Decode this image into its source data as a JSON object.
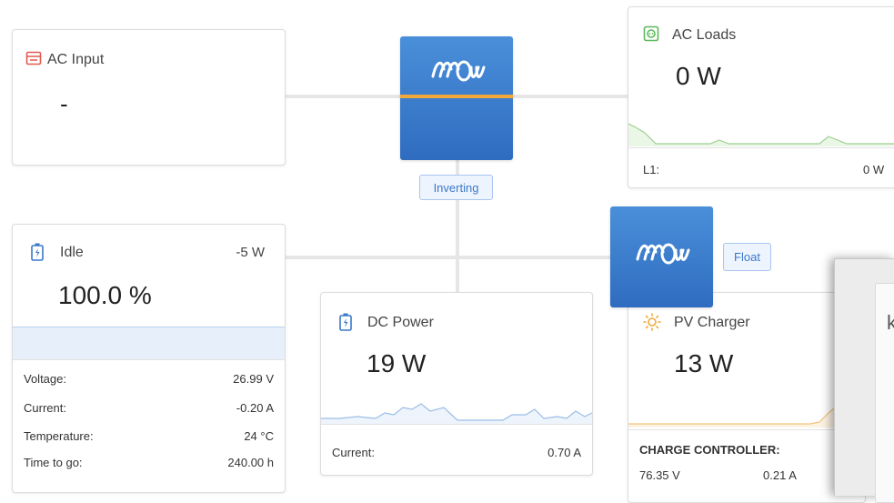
{
  "ac_input": {
    "title": "AC Input",
    "value": "-"
  },
  "inverter": {
    "status": "Inverting"
  },
  "ac_loads": {
    "title": "AC Loads",
    "value": "0 W",
    "l1_label": "L1:",
    "l1_value": "0 W"
  },
  "battery": {
    "state": "Idle",
    "power": "-5 W",
    "soc": "100.0 %",
    "rows": [
      {
        "label": "Voltage:",
        "value": "26.99 V"
      },
      {
        "label": "Current:",
        "value": "-0.20 A"
      },
      {
        "label": "Temperature:",
        "value": "24 °C"
      },
      {
        "label": "Time to go:",
        "value": "240.00 h"
      }
    ]
  },
  "dc_power": {
    "title": "DC Power",
    "value": "19 W",
    "current_label": "Current:",
    "current_value": "0.70 A"
  },
  "mppt": {
    "status": "Float"
  },
  "pv_charger": {
    "title": "PV Charger",
    "value": "13 W",
    "section_label": "CHARGE CONTROLLER:",
    "voltage": "76.35 V",
    "current": "0.21 A"
  },
  "overlay": {
    "letter": "k"
  },
  "colors": {
    "accent": "#3a78c9",
    "orange": "#f0a83a",
    "green": "#7ac36a",
    "battery_fill": "#e7f0fa"
  }
}
